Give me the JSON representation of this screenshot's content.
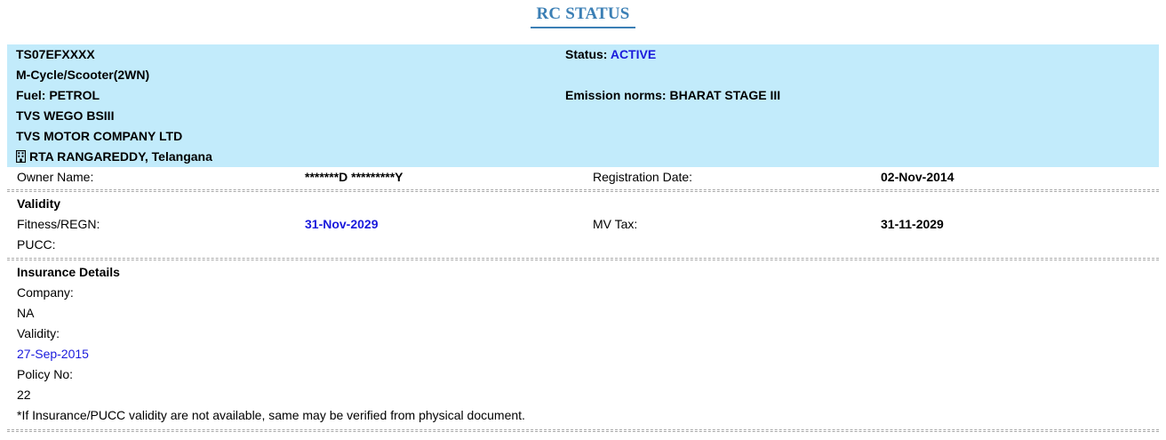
{
  "title": "RC STATUS",
  "vehicle": {
    "reg_no": "TS07EFXXXX",
    "class": "M-Cycle/Scooter(2WN)",
    "fuel": "Fuel: PETROL",
    "model": "TVS WEGO BSIII",
    "maker": "TVS MOTOR COMPANY LTD",
    "rta": "RTA RANGAREDDY, Telangana",
    "status_label": "Status:",
    "status_value": "ACTIVE",
    "emission": "Emission norms: BHARAT STAGE III"
  },
  "owner": {
    "label": "Owner Name:",
    "value": "*******D *********Y",
    "reg_date_label": "Registration Date:",
    "reg_date_value": "02-Nov-2014"
  },
  "validity": {
    "heading": "Validity",
    "fitness_label": "Fitness/REGN:",
    "fitness_value": "31-Nov-2029",
    "mvtax_label": "MV Tax:",
    "mvtax_value": "31-11-2029",
    "pucc_label": "PUCC:"
  },
  "insurance": {
    "heading": "Insurance Details",
    "company_label": "Company:",
    "company_value": "NA",
    "validity_label": "Validity:",
    "validity_value": "27-Sep-2015",
    "policy_label": "Policy No:",
    "policy_value": "22",
    "note": "*If Insurance/PUCC validity are not available, same may be verified from physical document."
  },
  "colors": {
    "title": "#3b7fb5",
    "highlight_bg": "#c2ebfb",
    "link_blue": "#1a1adc"
  }
}
